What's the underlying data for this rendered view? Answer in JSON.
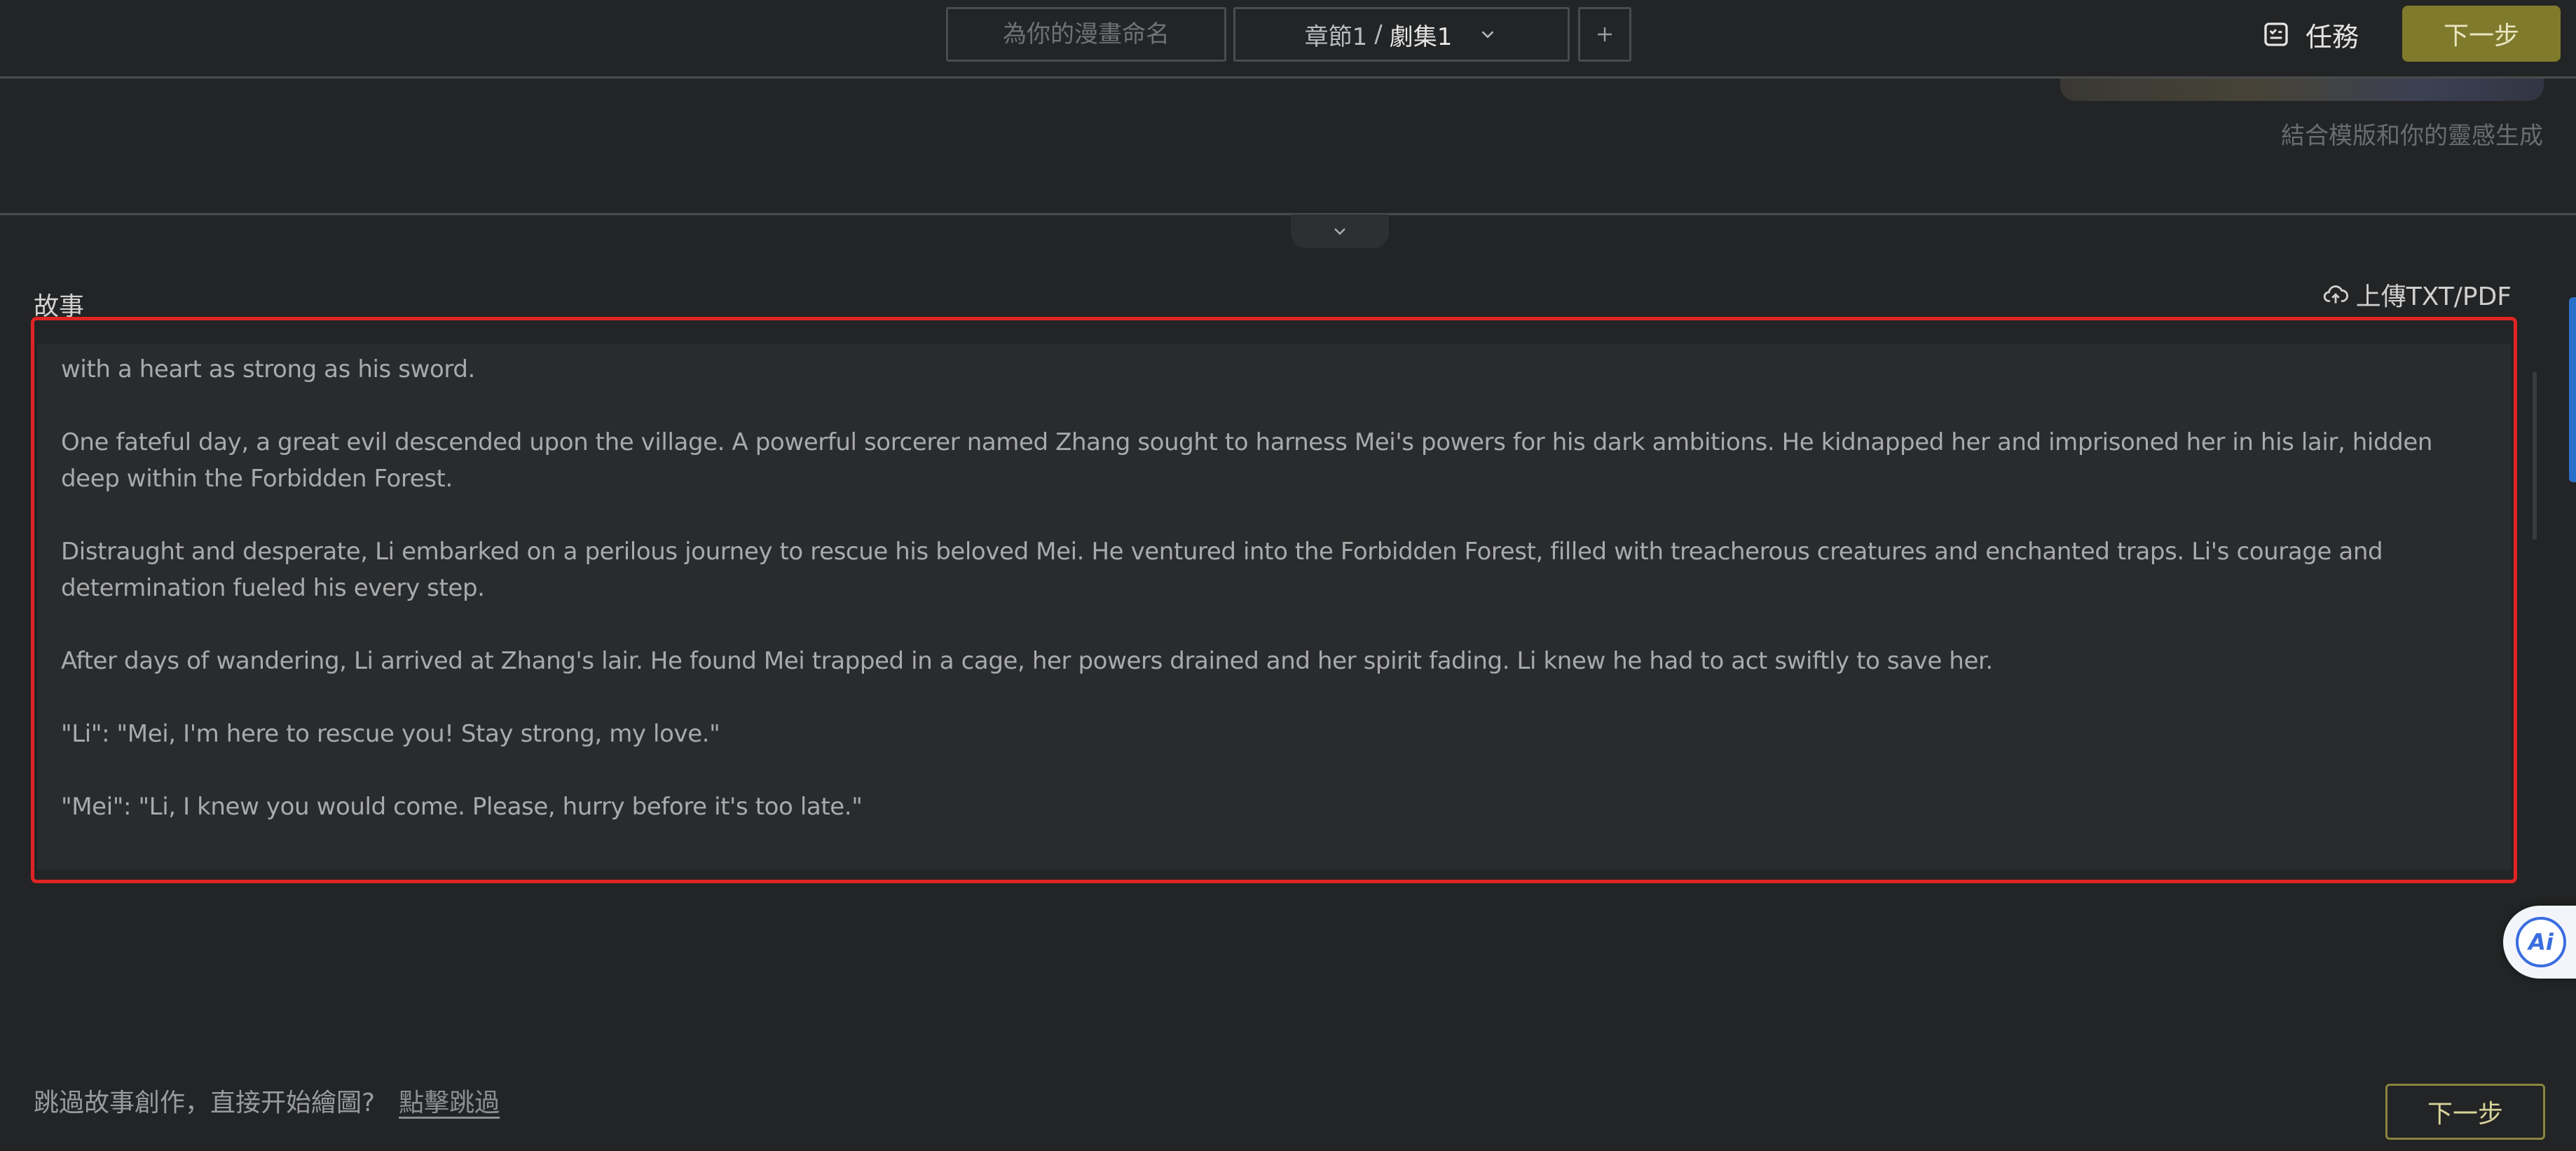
{
  "header": {
    "name_placeholder": "為你的漫畫命名",
    "chapter_label": "章節1",
    "chapter_sep": "/",
    "episode_label": "劇集1",
    "add_label": "+",
    "task_label": "任務",
    "next_label": "下一步"
  },
  "upper": {
    "hint": "結合模版和你的靈感生成"
  },
  "story": {
    "label": "故事",
    "upload_label": "上傳TXT/PDF",
    "paragraphs": [
      "with a heart as strong as his sword.",
      "One fateful day, a great evil descended upon the village. A powerful sorcerer named Zhang sought to harness Mei's powers for his dark ambitions. He kidnapped her and imprisoned her in his lair, hidden deep within the Forbidden Forest.",
      "Distraught and desperate, Li embarked on a perilous journey to rescue his beloved Mei. He ventured into the Forbidden Forest, filled with treacherous creatures and enchanted traps. Li's courage and determination fueled his every step.",
      "After days of wandering, Li arrived at Zhang's lair. He found Mei trapped in a cage, her powers drained and her spirit fading. Li knew he had to act swiftly to save her.",
      "\"Li\": \"Mei, I'm here to rescue you! Stay strong, my love.\"",
      "\"Mei\": \"Li, I knew you would come. Please, hurry before it's too late.\""
    ]
  },
  "ai_badge": "Ai",
  "footer": {
    "skip_text": "跳過故事創作，直接开始繪圖?",
    "skip_link": "點擊跳過",
    "next_label": "下一步"
  },
  "colors": {
    "background": "#232425",
    "accent_yellow": "#7f7a2c",
    "highlight_red": "#e02424",
    "ai_blue": "#3a6de0"
  }
}
